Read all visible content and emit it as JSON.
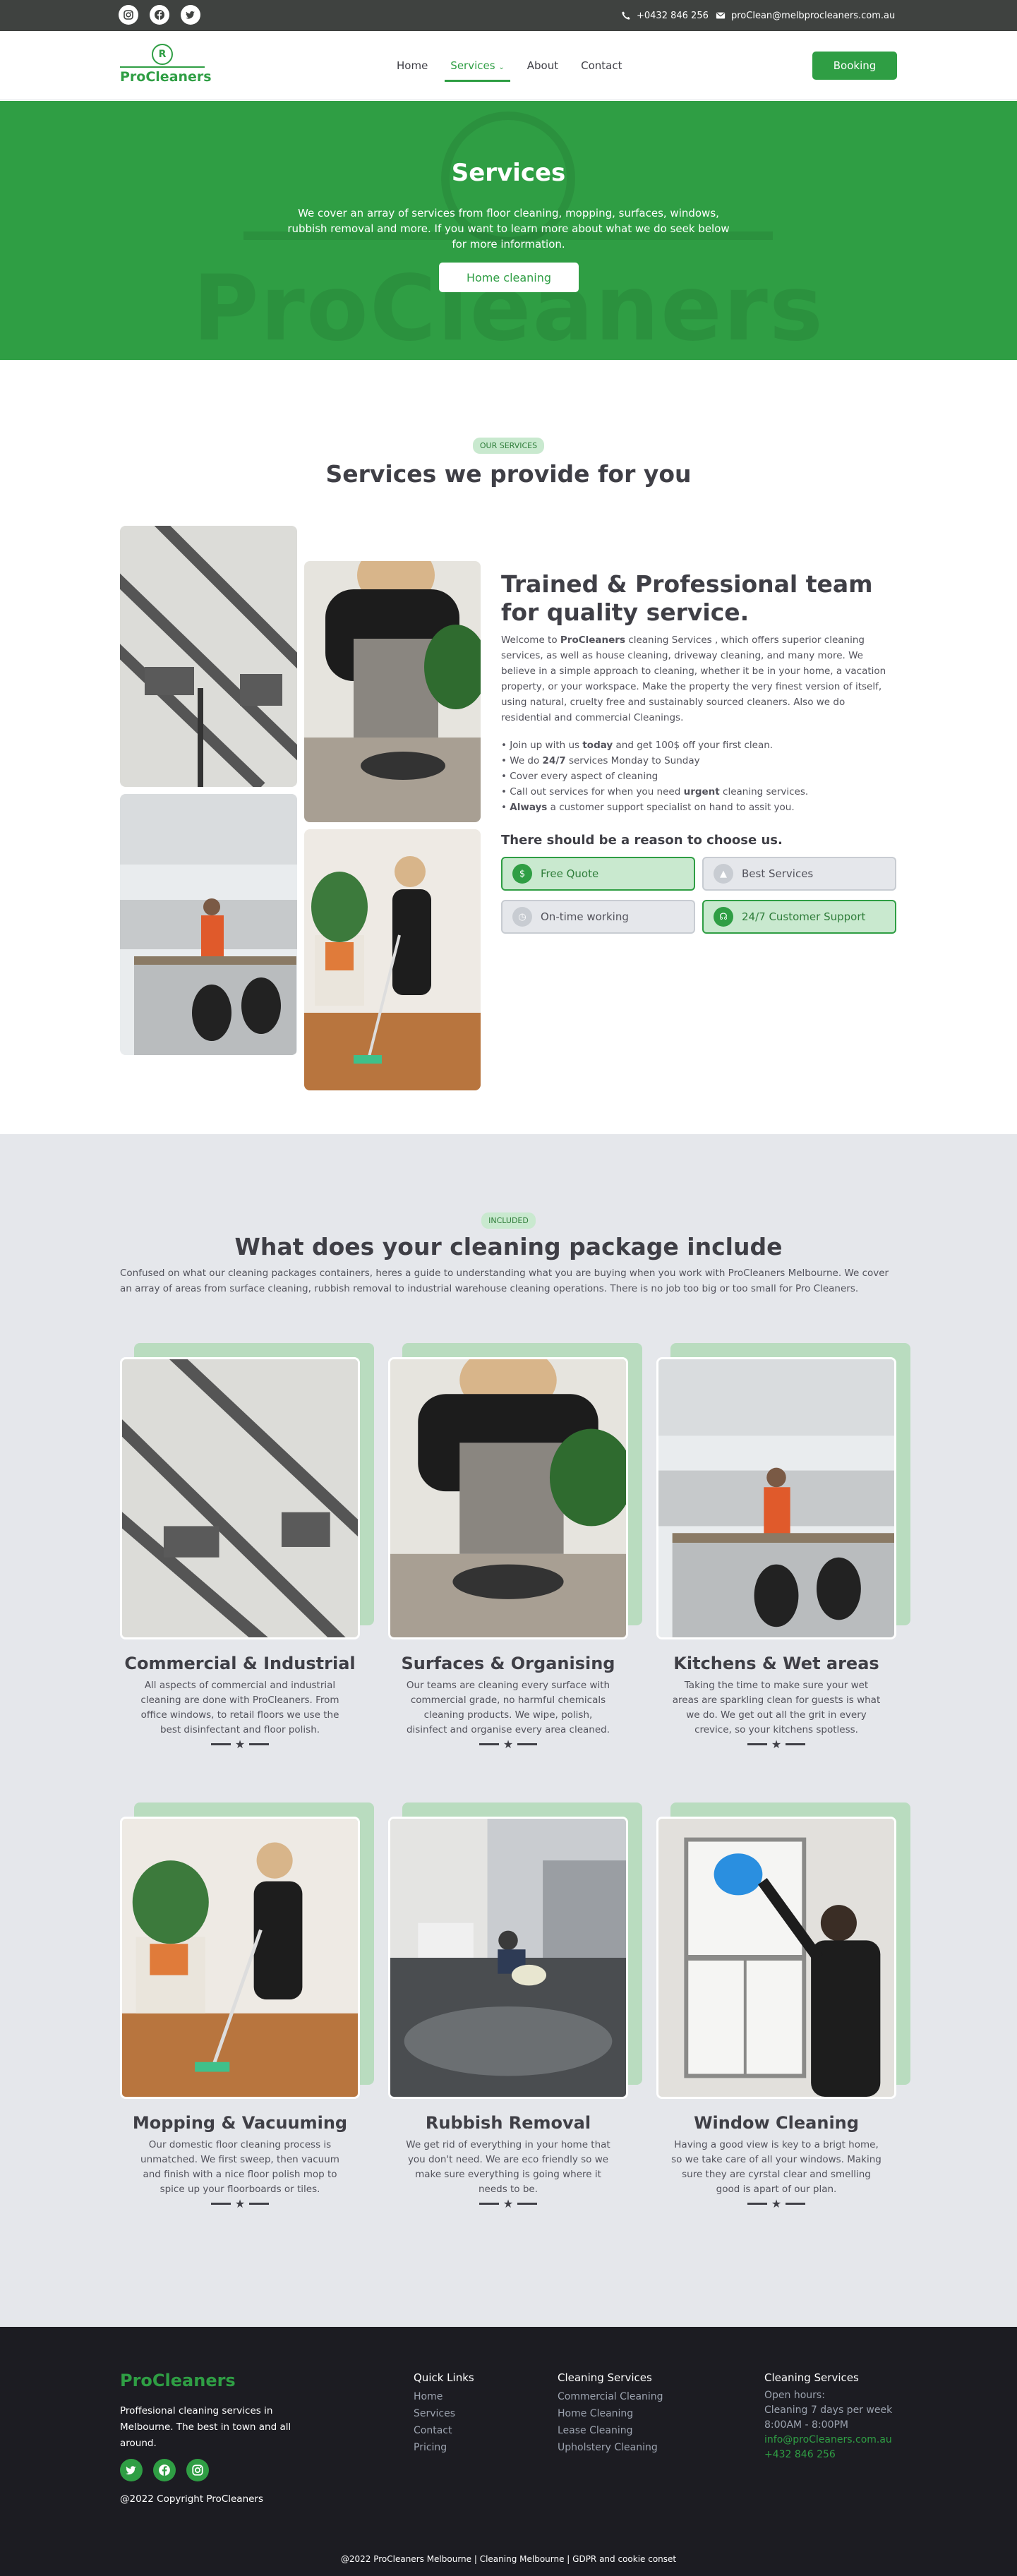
{
  "topbar": {
    "phone": "+0432 846 256",
    "email": "proClean@melbprocleaners.com.au"
  },
  "nav": {
    "brand": "ProCleaners",
    "links": [
      "Home",
      "Services",
      "About",
      "Contact"
    ],
    "active": "Services",
    "booking": "Booking"
  },
  "hero": {
    "title": "Services",
    "text": "We cover an array of services from floor cleaning, mopping, surfaces, windows, rubbish removal and more. If you want to learn more about what we do seek below for more information.",
    "button": "Home cleaning",
    "watermark": "ProCleaners"
  },
  "services": {
    "badge": "OUR SERVICES",
    "title": "Services we provide for you"
  },
  "about": {
    "title": "Trained & Professional team for quality service.",
    "desc_pre": "Welcome to ",
    "desc_brand": "ProCleaners",
    "desc_post": " cleaning Services , which offers superior cleaning services, as well as house cleaning, driveway cleaning, and many more. We believe in a simple approach to cleaning, whether it be in your home, a vacation property, or your workspace. Make the property the very finest version of itself, using natural, cruelty free and sustainably sourced cleaners. Also we do residential and commercial Cleanings.",
    "bullets": [
      {
        "pre": "Join up with us ",
        "bold": "today",
        "post": " and get 100$ off your first clean."
      },
      {
        "pre": "We do ",
        "bold": "24/7",
        "post": " services Monday to Sunday"
      },
      {
        "pre": "Cover every aspect of cleaning",
        "bold": "",
        "post": ""
      },
      {
        "pre": "Call out services for when you need ",
        "bold": "urgent",
        "post": " cleaning services."
      },
      {
        "pre": "",
        "bold": "Always",
        "post": " a customer support specialist on hand to assit you."
      }
    ],
    "reasons_title": "There should be a reason to choose us.",
    "reasons": [
      "Free Quote",
      "Best Services",
      "On-time working",
      "24/7 Customer Support"
    ]
  },
  "included": {
    "badge": "INCLUDED",
    "title": "What does your cleaning package include",
    "text": "Confused on what our cleaning packages containers, heres a guide to understanding what you are buying when you work with ProCleaners Melbourne. We cover an array of areas from surface cleaning, rubbish removal to industrial warehouse cleaning operations. There is no job too big or too small for Pro Cleaners.",
    "cards": [
      {
        "title": "Commercial & Industrial",
        "text": "All aspects of commercial and industrial cleaning are done with ProCleaners. From office windows, to retail floors we use the best disinfectant and floor polish."
      },
      {
        "title": "Surfaces & Organising",
        "text": "Our teams are cleaning every surface with commercial grade, no harmful chemicals cleaning products. We wipe, polish, disinfect and organise every area cleaned."
      },
      {
        "title": "Kitchens & Wet areas",
        "text": "Taking the time to make sure your wet areas are sparkling clean for guests is what we do. We get out all the grit in every crevice, so your kitchens spotless."
      },
      {
        "title": "Mopping & Vacuuming",
        "text": "Our domestic floor cleaning process is unmatched. We first sweep, then vacuum and finish with a nice floor polish mop to spice up your floorboards or tiles."
      },
      {
        "title": "Rubbish Removal",
        "text": "We get rid of everything in your home that you don't need. We are eco friendly so we make sure everything is going where it needs to be."
      },
      {
        "title": "Window Cleaning",
        "text": "Having a good view is key to a brigt home, so we take care of all your windows. Making sure they are cyrstal clear and smelling good is apart of our plan."
      }
    ]
  },
  "footer": {
    "brand": "ProCleaners",
    "tagline": "Proffesional cleaning services in Melbourne. The best in town and all around.",
    "copyright": "@2022 Copyright ProCleaners",
    "quick_title": "Quick Links",
    "quick": [
      "Home",
      "Services",
      "Contact",
      "Pricing"
    ],
    "services_title": "Cleaning Services",
    "services": [
      "Commercial Cleaning",
      "Home Cleaning",
      "Lease Cleaning",
      "Upholstery Cleaning"
    ],
    "hours_title": "Cleaning Services",
    "hours": [
      "Open hours:",
      "Cleaning 7 days per week",
      "8:00AM - 8:00PM"
    ],
    "email": "info@proCleaners.com.au",
    "phone": "+432 846 256",
    "bottom": "@2022 ProCleaners Melbourne | Cleaning Melbourne | GDPR and cookie conset"
  },
  "colors": {
    "accent": "#2f9e44",
    "dark": "#3f3f46",
    "footer": "#1c1c22"
  }
}
